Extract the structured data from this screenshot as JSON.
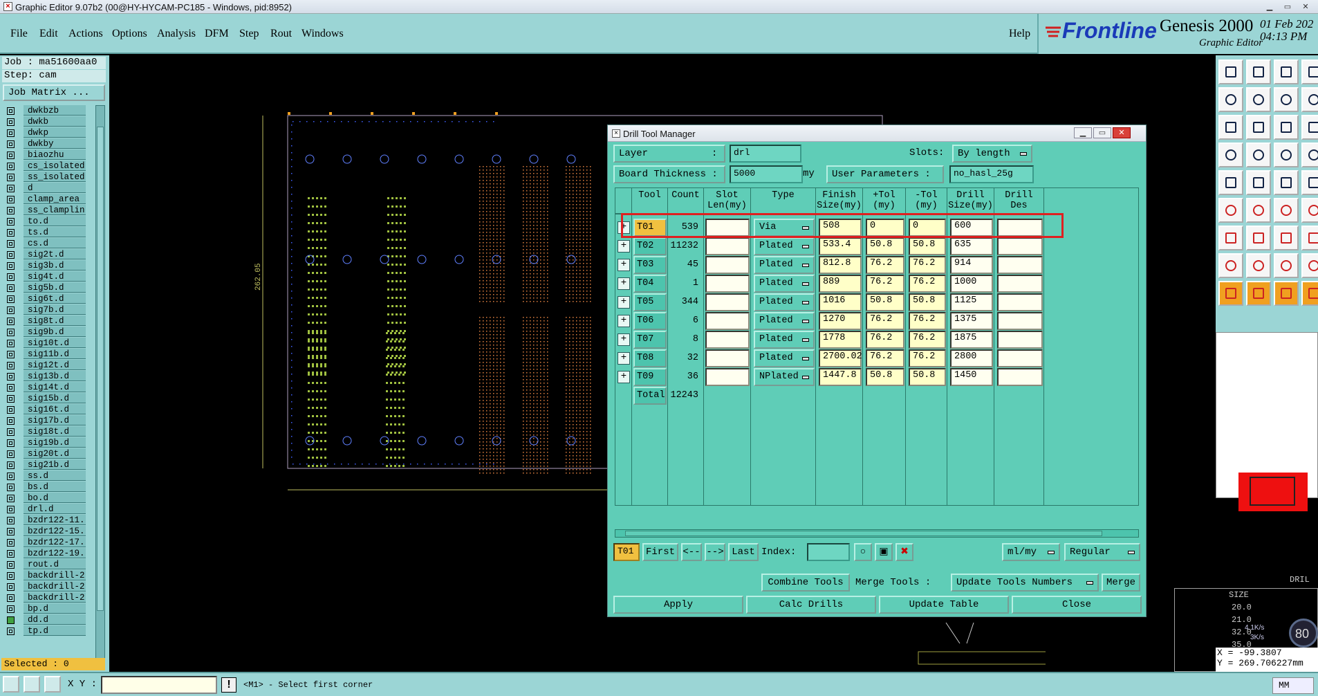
{
  "window": {
    "title": "Graphic Editor 9.07b2 (00@HY-HYCAM-PC185 - Windows, pid:8952)"
  },
  "menu": {
    "items": [
      "File",
      "Edit",
      "Actions",
      "Options",
      "Analysis",
      "DFM",
      "Step",
      "Rout",
      "Windows"
    ],
    "help": "Help"
  },
  "brand": {
    "logo": "Frontline",
    "product": "Genesis 2000",
    "subtitle": "Graphic Editor",
    "date": "01 Feb 202",
    "time": "04:13 PM"
  },
  "left": {
    "job": "Job : ma51600aa0",
    "step": "Step: cam",
    "job_matrix": "Job Matrix ...",
    "layers": [
      "dwkbzb",
      "dwkb",
      "dwkp",
      "dwkby",
      "biaozhu",
      "cs_isolated",
      "ss_isolated",
      "d",
      "clamp_area",
      "ss_clamplin",
      "to.d",
      "ts.d",
      "cs.d",
      "sig2t.d",
      "sig3b.d",
      "sig4t.d",
      "sig5b.d",
      "sig6t.d",
      "sig7b.d",
      "sig8t.d",
      "sig9b.d",
      "sig10t.d",
      "sig11b.d",
      "sig12t.d",
      "sig13b.d",
      "sig14t.d",
      "sig15b.d",
      "sig16t.d",
      "sig17b.d",
      "sig18t.d",
      "sig19b.d",
      "sig20t.d",
      "sig21b.d",
      "ss.d",
      "bs.d",
      "bo.d",
      "drl.d",
      "bzdr122-11.",
      "bzdr122-15.",
      "bzdr122-17.",
      "bzdr122-19.",
      "rout.d",
      "backdrill-2",
      "backdrill-2",
      "backdrill-2",
      "bp.d",
      "dd.d",
      "tp.d"
    ],
    "selected": "Selected : 0"
  },
  "canvas": {
    "dimension": "262.05"
  },
  "dialog": {
    "title": "Drill Tool Manager",
    "layer_label": "Layer",
    "layer_colon": ":",
    "layer_value": "drl",
    "slots_label": "Slots:",
    "slots_value": "By length",
    "board_thickness_label": "Board Thickness :",
    "board_thickness_value": "5000",
    "board_thickness_unit": "my",
    "user_params_label": "User Parameters :",
    "user_params_value": "no_hasl_25g",
    "headers": [
      "",
      "Tool",
      "Count",
      "Slot\nLen(my)",
      "Type",
      "Finish\nSize(my)",
      "+Tol\n(my)",
      "-Tol\n(my)",
      "Drill\nSize(my)",
      "Drill\nDes"
    ],
    "rows": [
      {
        "tool": "T01",
        "count": "539",
        "type": "Via",
        "finish": "508",
        "ptol": "0",
        "ntol": "0",
        "drill": "600"
      },
      {
        "tool": "T02",
        "count": "11232",
        "type": "Plated",
        "finish": "533.4",
        "ptol": "50.8",
        "ntol": "50.8",
        "drill": "635"
      },
      {
        "tool": "T03",
        "count": "45",
        "type": "Plated",
        "finish": "812.8",
        "ptol": "76.2",
        "ntol": "76.2",
        "drill": "914"
      },
      {
        "tool": "T04",
        "count": "1",
        "type": "Plated",
        "finish": "889",
        "ptol": "76.2",
        "ntol": "76.2",
        "drill": "1000"
      },
      {
        "tool": "T05",
        "count": "344",
        "type": "Plated",
        "finish": "1016",
        "ptol": "50.8",
        "ntol": "50.8",
        "drill": "1125"
      },
      {
        "tool": "T06",
        "count": "6",
        "type": "Plated",
        "finish": "1270",
        "ptol": "76.2",
        "ntol": "76.2",
        "drill": "1375"
      },
      {
        "tool": "T07",
        "count": "8",
        "type": "Plated",
        "finish": "1778",
        "ptol": "76.2",
        "ntol": "76.2",
        "drill": "1875"
      },
      {
        "tool": "T08",
        "count": "32",
        "type": "Plated",
        "finish": "2700.02",
        "ptol": "76.2",
        "ntol": "76.2",
        "drill": "2800"
      },
      {
        "tool": "T09",
        "count": "36",
        "type": "NPlated",
        "finish": "1447.8",
        "ptol": "50.8",
        "ntol": "50.8",
        "drill": "1450"
      }
    ],
    "total_label": "Total",
    "total_count": "12243",
    "nav": {
      "current": "T01",
      "first": "First",
      "prev": "<--",
      "next": "-->",
      "last": "Last",
      "index_label": "Index:",
      "unit": "ml/my",
      "mode": "Regular"
    },
    "combine_tools": "Combine Tools",
    "merge_tools_label": "Merge Tools :",
    "merge_option": "Update Tools Numbers",
    "merge": "Merge",
    "apply": "Apply",
    "calc_drills": "Calc Drills",
    "update_table": "Update Table",
    "close": "Close"
  },
  "right_panel": {
    "drill_label": "DRIL",
    "size_header": "SIZE",
    "sizes": [
      "20.0",
      "21.0",
      "32.0",
      "35.0"
    ],
    "net_up": "4.1K/s",
    "net_down": "3K/s",
    "percent": "80",
    "x_coord": "X = -99.3807",
    "y_coord": "Y = 269.706227mm"
  },
  "status": {
    "xy_label": "X Y :",
    "message": "<M1> - Select first corner",
    "unit": "MM"
  },
  "colors": {
    "panel": "#9bd5d5",
    "dialog": "#5fcdb7",
    "highlight": "#e02020",
    "selected_tool": "#f0c040"
  }
}
